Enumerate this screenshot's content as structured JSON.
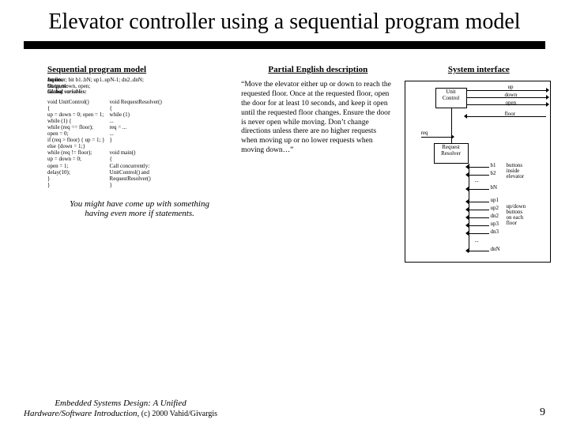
{
  "title": "Elevator controller using a sequential program model",
  "headings": {
    "sequential": "Sequential program model",
    "partial": "Partial English description",
    "system": "System interface"
  },
  "meta": {
    "inputs_label": "Inputs:",
    "inputs": " int floor; bit b1..bN; up1..upN-1; dn2..dnN;",
    "outputs_label": "Outputs:",
    "outputs": " bit up, down, open;",
    "globals_label": "Global variables:",
    "globals": " int req;"
  },
  "code_left": "void UnitControl()\n{\n  up = down = 0; open = 1;\n  while (1) {\n    while (req == floor);\n    open = 0;\n    if (req > floor) { up = 1; }\n    else {down = 1;}\n    while (req != floor);\n    up = down = 0;\n    open = 1;\n    delay(10);\n  }\n}",
  "code_right": "void RequestResolver()\n{\n  while (1)\n    ...\n    req = ...\n    ...\n}\n\nvoid main()\n{\n  Call concurrently:\n    UnitControl() and\n    RequestResolver()\n}",
  "note": "You might have come up with something having even more if statements.",
  "english": "“Move the elevator either up or down to reach the requested floor. Once at the requested floor, open the door for at least 10 seconds, and keep it open until the requested floor changes. Ensure the door is never open while moving. Don’t change directions unless there are no higher requests when moving up or no lower requests when moving down…”",
  "diagram": {
    "unit_control": "Unit\nControl",
    "request_resolver": "Request\nResolver",
    "signals": {
      "up": "up",
      "down": "down",
      "open": "open",
      "floor": "floor",
      "req": "req"
    },
    "b": {
      "b1": "b1",
      "b2": "b2",
      "bN": "bN",
      "dots": "..."
    },
    "up_btn": {
      "up1": "up1",
      "up2": "up2",
      "dots": "..."
    },
    "dn_btn": {
      "dn2": "dn2",
      "up3": "up3",
      "dn3": "dn3",
      "dots": "...",
      "dnN": "dnN"
    },
    "annot": {
      "buttons_inside": "buttons\ninside\nelevator",
      "up_down_buttons": "up/down\nbuttons\non each\nfloor"
    }
  },
  "footer": {
    "credit_line1": "Embedded Systems Design: A Unified",
    "credit_line2": "Hardware/Software Introduction,",
    "copyright": " (c) 2000 Vahid/Givargis",
    "page": "9"
  }
}
